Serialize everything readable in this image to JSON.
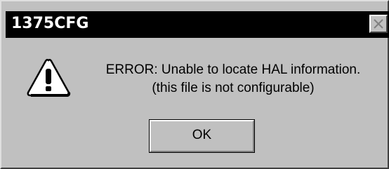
{
  "window": {
    "title": "1375CFG",
    "close_icon": "close-icon"
  },
  "message": {
    "icon": "warning-icon",
    "line1": "ERROR: Unable to locate HAL information.",
    "line2": "(this file is not configurable)"
  },
  "buttons": {
    "ok_label": "OK"
  },
  "colors": {
    "titlebar": "#000000",
    "face": "#c0c0c0",
    "icon_fill": "#ffffff"
  }
}
